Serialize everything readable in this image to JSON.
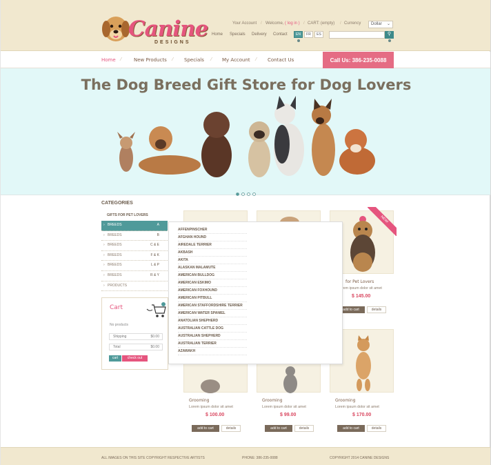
{
  "header": {
    "logo_text": "Canine",
    "logo_sub": "DESIGNS",
    "your_account": "Your Account",
    "welcome": "Welcome,",
    "login": "( log in )",
    "cart": "CART: (empty)",
    "currency_label": "Currency",
    "currency_value": "Dollar",
    "nav_small": [
      "Home",
      "Specials",
      "Delivery",
      "Contact"
    ],
    "languages": [
      "EN",
      "FR",
      "ES"
    ]
  },
  "menu": {
    "items": [
      "Home",
      "New Products",
      "Specials",
      "My Account",
      "Contact Us"
    ],
    "call_us": "Call Us:  386-235-0088"
  },
  "banner": {
    "title": "The Dog Breed Gift Store for Dog Lovers",
    "dot_count": 4
  },
  "sidebar": {
    "categories_heading": "CATEGORIES",
    "gifts": "GIFTS FOR PET LOVERS",
    "categories": [
      {
        "label": "BREEDS",
        "range": "A"
      },
      {
        "label": "BREEDS",
        "range": "B"
      },
      {
        "label": "BREEDS",
        "range": "C & E"
      },
      {
        "label": "BREEDS",
        "range": "F & K"
      },
      {
        "label": "BREEDS",
        "range": "L & P"
      },
      {
        "label": "BREEDS",
        "range": "R & Y"
      },
      {
        "label": "PRODUCTS",
        "range": ""
      }
    ]
  },
  "cart_box": {
    "title": "Cart",
    "no_products": "No products",
    "shipping_label": "Shipping",
    "shipping_value": "$0.00",
    "total_label": "Total",
    "total_value": "$0.00",
    "cart_btn": "cart",
    "checkout_btn": "check out"
  },
  "dropdown": {
    "items": [
      "AFFENPINSCHER",
      "AFGHAN HOUND",
      "AIREDALE TERRIER",
      "AKBASH",
      "AKITA",
      "ALASKAN MALAMUTE",
      "AMERICAN BULLDOG",
      "AMERICAN ESKIMO",
      "AMERICAN FOXHOUND",
      "AMERICAN PITBULL",
      "AMERICAN STAFFORDSHIRE TERRIER",
      "AMERICAN WATER SPANIEL",
      "ANATOLIAN SHEPHERD",
      "AUSTRALIAN CATTLE DOG",
      "AUSTRALIAN SHEPHERD",
      "AUSTRALIAN TERRIER",
      "AZAWAKH"
    ]
  },
  "products": {
    "top_right": {
      "title": "for Pet Lovers",
      "desc": "Lorem ipsum dolor sit amet",
      "price": "$ 145.00",
      "badge": "NEW!"
    },
    "bottom": [
      {
        "title": "Grooming",
        "desc": "Lorem ipsum dolor sit amet",
        "price": "$ 100.00"
      },
      {
        "title": "Grooming",
        "desc": "Lorem ipsum dolor sit amet",
        "price": "$ 99.00"
      },
      {
        "title": "Grooming",
        "desc": "Lorem ipsum dolor sit amet",
        "price": "$ 170.00"
      }
    ],
    "add_to_cart": "add to cart",
    "details": "details"
  },
  "footer": {
    "copyright_left": "ALL IMAGES ON THIS SITE COPYRIGHT RESPECTIVE ARTISTS",
    "phone": "PHONE: 386-235-0088",
    "copyright_right": "COPYRIGHT  2014 CANINE DESIGNS"
  }
}
